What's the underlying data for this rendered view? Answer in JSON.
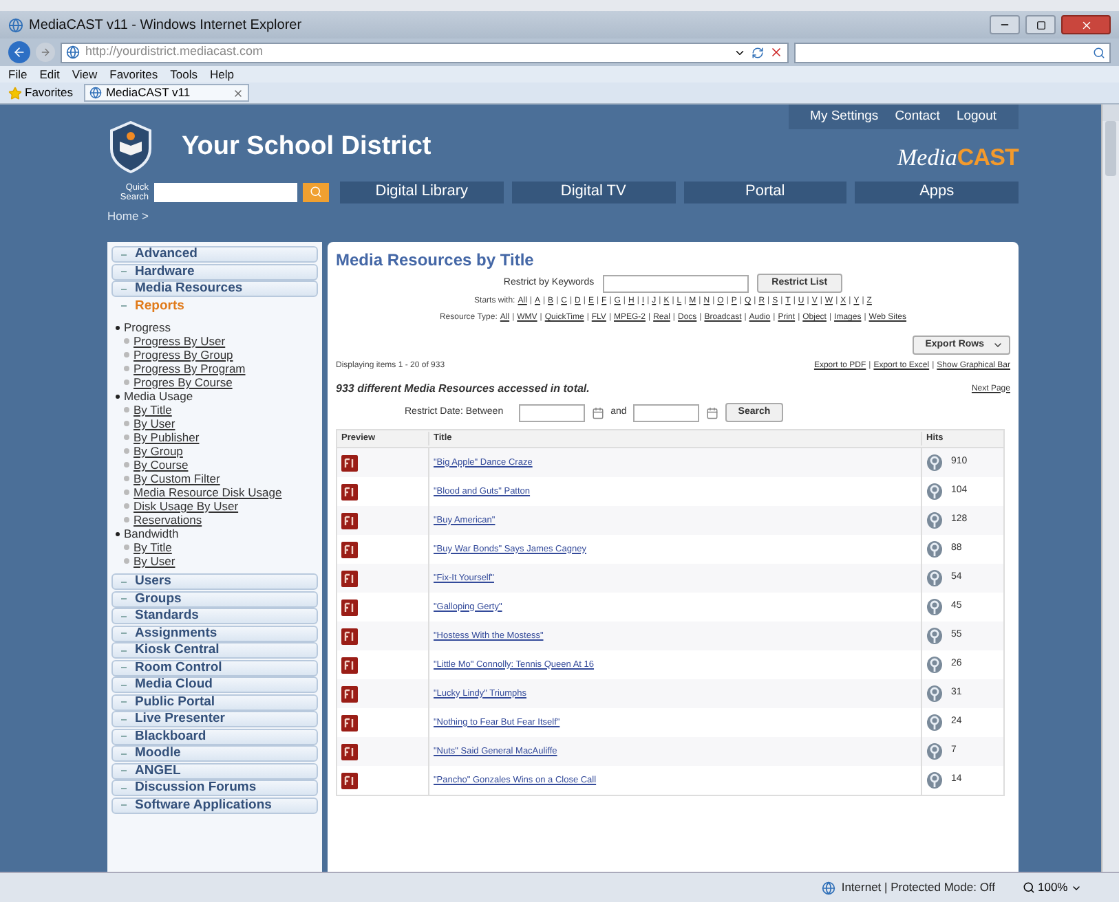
{
  "browser": {
    "title": "MediaCAST v11 - Windows Internet Explorer",
    "url": "http://yourdistrict.mediacast.com",
    "menu": [
      "File",
      "Edit",
      "View",
      "Favorites",
      "Tools",
      "Help"
    ],
    "favorites": "Favorites",
    "tabs": [
      {
        "label": "MediaCAST v11",
        "selected": true
      }
    ],
    "status": "Internet | Protected Mode: Off",
    "zoom": "100%"
  },
  "header": {
    "title": "Your School District",
    "top_links": [
      "My Settings",
      "Contact",
      "Logout"
    ],
    "logo": {
      "script": "Media",
      "bold": "CAST"
    },
    "quick_search": {
      "label_lines": [
        "Quick",
        "Search"
      ]
    },
    "nav": [
      "Digital Library",
      "Digital TV",
      "Portal",
      "Apps"
    ],
    "breadcrumb": "Home >"
  },
  "sidebar": {
    "items": [
      {
        "label": "Advanced",
        "expanded": false
      },
      {
        "label": "Hardware",
        "expanded": false
      },
      {
        "label": "Media Resources",
        "expanded": false
      },
      {
        "label": "Reports",
        "expanded": true,
        "children": [
          {
            "label": "Progress",
            "children": [
              {
                "label": "Progress By User"
              },
              {
                "label": "Progress By Group"
              },
              {
                "label": "Progress By Program"
              },
              {
                "label": "Progres By Course"
              }
            ]
          },
          {
            "label": "Media Usage",
            "children": [
              {
                "label": "By Title"
              },
              {
                "label": "By User"
              },
              {
                "label": "By Publisher"
              },
              {
                "label": "By Group"
              },
              {
                "label": "By Course"
              },
              {
                "label": "By Custom Filter"
              },
              {
                "label": "Media Resource Disk Usage"
              },
              {
                "label": "Disk Usage By User"
              },
              {
                "label": "Reservations"
              }
            ]
          },
          {
            "label": "Bandwidth",
            "children": [
              {
                "label": "By Title"
              },
              {
                "label": "By User"
              }
            ]
          }
        ]
      },
      {
        "label": "Users",
        "expanded": false
      },
      {
        "label": "Groups",
        "expanded": false
      },
      {
        "label": "Standards",
        "expanded": false
      },
      {
        "label": "Assignments",
        "expanded": false
      },
      {
        "label": "Kiosk Central",
        "expanded": false
      },
      {
        "label": "Room Control",
        "expanded": false
      },
      {
        "label": "Media Cloud",
        "expanded": false
      },
      {
        "label": "Public Portal",
        "expanded": false
      },
      {
        "label": "Live Presenter",
        "expanded": false
      },
      {
        "label": "Blackboard",
        "expanded": false
      },
      {
        "label": "Moodle",
        "expanded": false
      },
      {
        "label": "ANGEL",
        "expanded": false
      },
      {
        "label": "Discussion Forums",
        "expanded": false
      },
      {
        "label": "Software Applications",
        "expanded": false
      }
    ]
  },
  "main": {
    "title": "Media Resources by Title",
    "separator": "|",
    "keyword_filter": {
      "label": "Restrict by Keywords",
      "button": "Restrict List"
    },
    "starts_with": {
      "label": "Starts with:",
      "letters": [
        "All",
        "A",
        "B",
        "C",
        "D",
        "E",
        "F",
        "G",
        "H",
        "I",
        "J",
        "K",
        "L",
        "M",
        "N",
        "O",
        "P",
        "Q",
        "R",
        "S",
        "T",
        "U",
        "V",
        "W",
        "X",
        "Y",
        "Z"
      ]
    },
    "resource_type": {
      "label": "Resource Type:",
      "types": [
        "All",
        "WMV",
        "QuickTime",
        "FLV",
        "MPEG-2",
        "Real",
        "Docs",
        "Broadcast",
        "Audio",
        "Print",
        "Object",
        "Images",
        "Web Sites"
      ]
    },
    "export_button": "Export Rows",
    "displaying": "Displaying items 1 - 20 of 933",
    "export_links": [
      "Export to PDF",
      "Export to Excel",
      "Show Graphical Bar"
    ],
    "summary": "933 different Media Resources accessed in total.",
    "next_page": "Next Page",
    "date_filter": {
      "label": "Restrict Date: Between",
      "and": "and",
      "button": "Search"
    },
    "table": {
      "columns": [
        "Preview",
        "Title",
        "Hits"
      ],
      "rows": [
        {
          "title": "\"Big Apple\" Dance Craze",
          "hits": "910"
        },
        {
          "title": "\"Blood and Guts\" Patton",
          "hits": "104"
        },
        {
          "title": "\"Buy American\"",
          "hits": "128"
        },
        {
          "title": "\"Buy War Bonds\" Says James Cagney",
          "hits": "88"
        },
        {
          "title": "\"Fix-It Yourself\"",
          "hits": "54"
        },
        {
          "title": "\"Galloping Gerty\"",
          "hits": "45"
        },
        {
          "title": "\"Hostess With the Mostess\"",
          "hits": "55"
        },
        {
          "title": "\"Little Mo\" Connolly: Tennis Queen At 16",
          "hits": "26"
        },
        {
          "title": "\"Lucky Lindy\" Triumphs",
          "hits": "31"
        },
        {
          "title": "\"Nothing to Fear But Fear Itself\"",
          "hits": "24"
        },
        {
          "title": "\"Nuts\" Said General MacAuliffe",
          "hits": "7"
        },
        {
          "title": "\"Pancho\" Gonzales Wins on a Close Call",
          "hits": "14"
        }
      ]
    }
  }
}
